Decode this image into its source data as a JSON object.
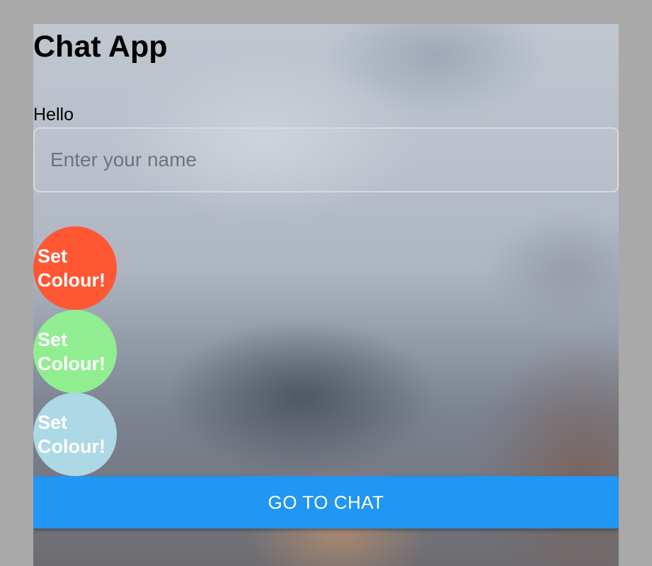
{
  "app": {
    "title": "Chat App"
  },
  "form": {
    "label": "Hello",
    "name_placeholder": "Enter your name",
    "name_value": ""
  },
  "color_buttons": [
    {
      "line1": "Set",
      "line2": "Colour!",
      "color": "#ff5733"
    },
    {
      "line1": "Set",
      "line2": "Colour!",
      "color": "#90ee90"
    },
    {
      "line1": "Set",
      "line2": "Colour!",
      "color": "#add8e6"
    }
  ],
  "chat_button": {
    "label": "GO TO CHAT",
    "color": "#2196f3"
  },
  "colors": {
    "text_on_accent": "#ffffff"
  }
}
